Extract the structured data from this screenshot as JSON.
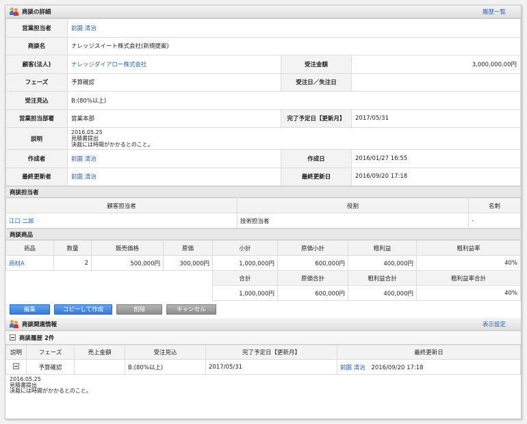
{
  "header": {
    "title": "商談の詳細",
    "history_link": "履歴一覧"
  },
  "detail": {
    "owner_label": "営業担当者",
    "owner_value": "前園 清治",
    "name_label": "商談名",
    "name_value": "ナレッジスイート株式会社(新規提案)",
    "customer_label": "顧客(法人)",
    "customer_value": "ナレッジダイアロー株式会社",
    "amount_label": "受注金額",
    "amount_value": "3,000,000.00円",
    "phase_label": "フェーズ",
    "phase_value": "予算確認",
    "orderdate_label": "受注日／失注日",
    "orderdate_value": "",
    "prospect_label": "受注見込",
    "prospect_value": "B:(80%以上)",
    "dept_label": "営業担当部署",
    "dept_value": "営業本部",
    "duedate_label": "完了予定日【更新月】",
    "duedate_value": "2017/05/31",
    "desc_label": "説明",
    "desc_value": "2016.05.25\n見積書提出\n決裁には時間がかかるとのこと。",
    "creator_label": "作成者",
    "creator_value": "前園 清治",
    "created_label": "作成日",
    "created_value": "2016/01/27 16:55",
    "updater_label": "最終更新者",
    "updater_value": "前園 清治",
    "updated_label": "最終更新日",
    "updated_value": "2016/09/20 17:18"
  },
  "contacts": {
    "title": "商談担当者",
    "headers": [
      "顧客担当者",
      "役割",
      "名刺"
    ],
    "row": {
      "person": "江口 二郎",
      "role": "技術担当者",
      "card": "-"
    }
  },
  "products": {
    "title": "商談商品",
    "headers": [
      "商品",
      "数量",
      "販売価格",
      "原価",
      "小計",
      "原価小計",
      "粗利益",
      "粗利益率"
    ],
    "row": {
      "product": "商材A",
      "qty": "2",
      "price": "500,000円",
      "cost": "300,000円",
      "subtotal": "1,000,000円",
      "cost_subtotal": "600,000円",
      "profit": "400,000円",
      "margin": "40%"
    },
    "total_headers": [
      "合計",
      "原価合計",
      "粗利益合計",
      "粗利益率合計"
    ],
    "totals": {
      "total": "1,000,000円",
      "cost_total": "600,000円",
      "profit_total": "400,000円",
      "margin_total": "40%"
    }
  },
  "buttons": {
    "edit": "編集",
    "copy": "コピーして作成",
    "delete": "削除",
    "cancel": "キャンセル"
  },
  "related": {
    "title": "商談関連情報",
    "settings_link": "表示設定",
    "history_title": "商談履歴 2件",
    "headers": [
      "説明",
      "フェーズ",
      "売上金額",
      "受注見込",
      "完了予定日【更新月】",
      "最終更新日"
    ],
    "row": {
      "phase": "予算確認",
      "sales": "",
      "prospect": "B:(80%以上)",
      "duedate": "2017/05/31",
      "updater": "前園 清治",
      "updated": "2016/09/20 17:18"
    },
    "desc": "2016.05.25\n見積書提出\n決裁には時間がかかるとのこと。"
  }
}
